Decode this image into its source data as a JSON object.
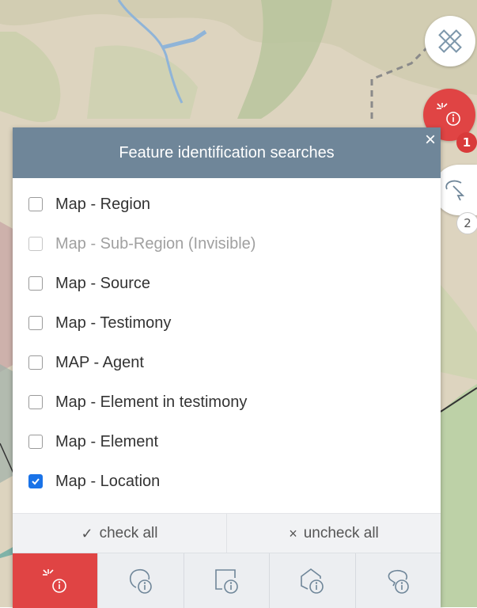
{
  "map": {
    "icons": {
      "measure": "measure-ruler-icon",
      "identify": "feature-identify-icon",
      "select": "select-pointer-icon"
    },
    "badges": {
      "identify": "1",
      "select": "2"
    }
  },
  "panel": {
    "title": "Feature identification searches",
    "close_label": "×",
    "items": [
      {
        "label": "Map - Region",
        "checked": false,
        "disabled": false
      },
      {
        "label": "Map - Sub-Region (Invisible)",
        "checked": false,
        "disabled": true
      },
      {
        "label": "Map - Source",
        "checked": false,
        "disabled": false
      },
      {
        "label": "Map - Testimony",
        "checked": false,
        "disabled": false
      },
      {
        "label": "MAP - Agent",
        "checked": false,
        "disabled": false
      },
      {
        "label": "Map - Element in testimony",
        "checked": false,
        "disabled": false
      },
      {
        "label": "Map - Element",
        "checked": false,
        "disabled": false
      },
      {
        "label": "Map - Location",
        "checked": true,
        "disabled": false
      }
    ],
    "check_all": {
      "glyph": "✓",
      "label": "check all"
    },
    "uncheck_all": {
      "glyph": "×",
      "label": "uncheck all"
    },
    "tabs": [
      {
        "icon": "point-identify-icon",
        "active": true
      },
      {
        "icon": "circle-identify-icon",
        "active": false
      },
      {
        "icon": "rectangle-identify-icon",
        "active": false
      },
      {
        "icon": "polygon-identify-icon",
        "active": false
      },
      {
        "icon": "lasso-identify-icon",
        "active": false
      }
    ]
  },
  "colors": {
    "accent_red": "#e04444",
    "header": "#6f8699",
    "checkbox_blue": "#1a73e8"
  }
}
